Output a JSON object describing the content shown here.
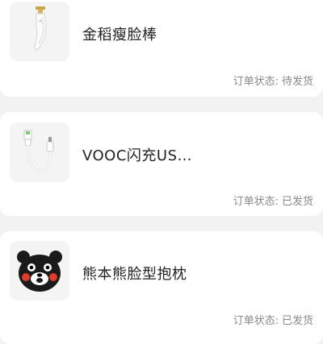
{
  "orders": [
    {
      "product_name": "金稻瘦脸棒",
      "status_label": "订单状态:",
      "status_value": "待发货",
      "thumbnail_icon": "facial-roller-icon"
    },
    {
      "product_name": "VOOC闪充US…",
      "status_label": "订单状态:",
      "status_value": "已发货",
      "thumbnail_icon": "usb-cable-icon"
    },
    {
      "product_name": "熊本熊脸型抱枕",
      "status_label": "订单状态:",
      "status_value": "已发货",
      "thumbnail_icon": "kumamon-pillow-icon"
    }
  ],
  "colors": {
    "page_background": "#f2f2f2",
    "card_background": "#ffffff",
    "title_text": "#222222",
    "status_text": "#888888"
  }
}
